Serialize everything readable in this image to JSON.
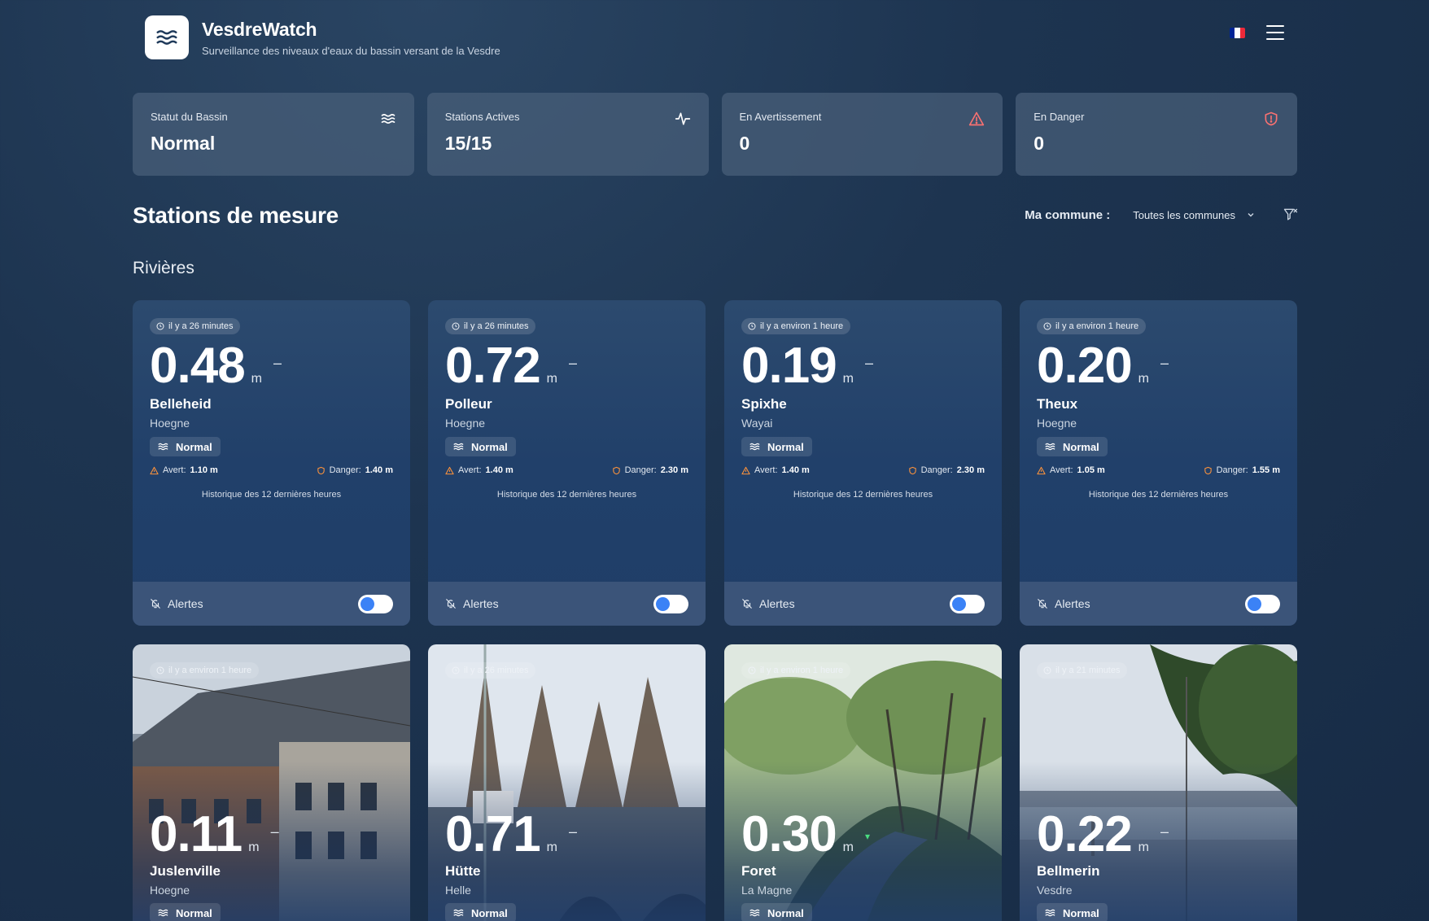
{
  "app": {
    "title": "VesdreWatch",
    "subtitle": "Surveillance des niveaux d'eaux du bassin versant de la Vesdre",
    "logo_icon": "waves-icon",
    "flag_colors": [
      "#002395",
      "#ffffff",
      "#ed2939"
    ]
  },
  "stats": [
    {
      "label": "Statut du Bassin",
      "value": "Normal",
      "icon": "waves-icon",
      "icon_color": "#ffffff"
    },
    {
      "label": "Stations Actives",
      "value": "15/15",
      "icon": "activity-icon",
      "icon_color": "#ffffff"
    },
    {
      "label": "En Avertissement",
      "value": "0",
      "icon": "warning-triangle-icon",
      "icon_color": "#f87171"
    },
    {
      "label": "En Danger",
      "value": "0",
      "icon": "shield-alert-icon",
      "icon_color": "#f87171"
    }
  ],
  "section": {
    "title": "Stations de mesure",
    "commune_label": "Ma commune :",
    "commune_value": "Toutes les communes",
    "subsection": "Rivières"
  },
  "stations": [
    {
      "time": "il y a 26 minutes",
      "level": "0.48",
      "unit": "m",
      "trend": "–",
      "name": "Belleheid",
      "river": "Hoegne",
      "status": "Normal",
      "avert": "1.10 m",
      "danger": "1.40 m",
      "history": "Historique des 12 dernières heures",
      "alerts": "Alertes"
    },
    {
      "time": "il y a 26 minutes",
      "level": "0.72",
      "unit": "m",
      "trend": "–",
      "name": "Polleur",
      "river": "Hoegne",
      "status": "Normal",
      "avert": "1.40 m",
      "danger": "2.30 m",
      "history": "Historique des 12 dernières heures",
      "alerts": "Alertes"
    },
    {
      "time": "il y a environ 1 heure",
      "level": "0.19",
      "unit": "m",
      "trend": "–",
      "name": "Spixhe",
      "river": "Wayai",
      "status": "Normal",
      "avert": "1.40 m",
      "danger": "2.30 m",
      "history": "Historique des 12 dernières heures",
      "alerts": "Alertes"
    },
    {
      "time": "il y a environ 1 heure",
      "level": "0.20",
      "unit": "m",
      "trend": "–",
      "name": "Theux",
      "river": "Hoegne",
      "status": "Normal",
      "avert": "1.05 m",
      "danger": "1.55 m",
      "history": "Historique des 12 dernières heures",
      "alerts": "Alertes"
    },
    {
      "time": "il y a environ 1 heure",
      "level": "0.11",
      "unit": "m",
      "trend": "–",
      "name": "Juslenville",
      "river": "Hoegne",
      "status": "Normal"
    },
    {
      "time": "il y a 26 minutes",
      "level": "0.71",
      "unit": "m",
      "trend": "–",
      "name": "Hütte",
      "river": "Helle",
      "status": "Normal"
    },
    {
      "time": "il y a environ 1 heure",
      "level": "0.30",
      "unit": "m",
      "trend": "▾",
      "name": "Foret",
      "river": "La Magne",
      "status": "Normal"
    },
    {
      "time": "il y a 21 minutes",
      "level": "0.22",
      "unit": "m",
      "trend": "–",
      "name": "Bellmerin",
      "river": "Vesdre",
      "status": "Normal"
    }
  ],
  "labels": {
    "avert": "Avert:",
    "danger": "Danger:"
  }
}
